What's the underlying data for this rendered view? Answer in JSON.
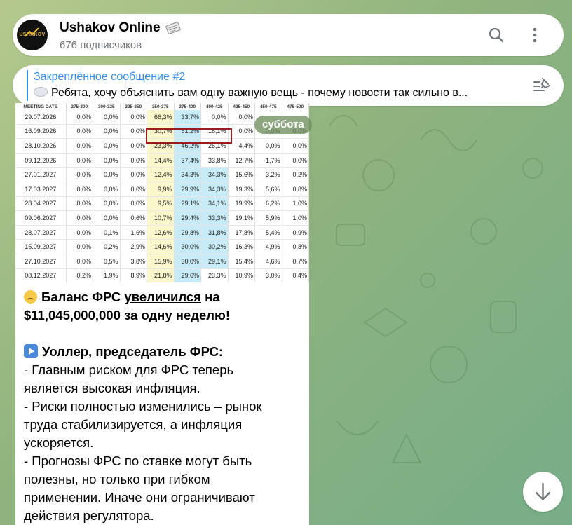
{
  "channel": {
    "name": "Ushakov Online",
    "subscribers": "676 подписчиков",
    "avatar_text": "USHAKOV",
    "title_icon": "newspaper-icon"
  },
  "header_actions": [
    {
      "icon": "search-icon"
    },
    {
      "icon": "more-vertical-icon"
    }
  ],
  "pinned": {
    "title": "Закреплённое сообщение #2",
    "text": "Ребята, хочу объяснить вам одну важную вещь - почему новости так сильно в...",
    "emoji_icon": "cloud-emoji-icon",
    "action_icon": "pinned-list-icon"
  },
  "date_pill": "суббота",
  "table": {
    "columns": [
      "MEETING DATE",
      "275-300",
      "300-325",
      "325-350",
      "350-375",
      "375-400",
      "400-425",
      "425-450",
      "450-475",
      "475-500"
    ],
    "rows": [
      [
        "29.07.2026",
        "0,0%",
        "0,0%",
        "0,0%",
        "66,3%",
        "33,7%",
        "0,0%",
        "0,0%",
        "",
        ""
      ],
      [
        "16.09.2026",
        "0,0%",
        "0,0%",
        "0,0%",
        "30,7%",
        "51,2%",
        "18,1%",
        "0,0%",
        "0,0%",
        "0,0%"
      ],
      [
        "28.10.2026",
        "0,0%",
        "0,0%",
        "0,0%",
        "23,3%",
        "46,2%",
        "26,1%",
        "4,4%",
        "0,0%",
        "0,0%"
      ],
      [
        "09.12.2026",
        "0,0%",
        "0,0%",
        "0,0%",
        "14,4%",
        "37,4%",
        "33,8%",
        "12,7%",
        "1,7%",
        "0,0%"
      ],
      [
        "27.01.2027",
        "0,0%",
        "0,0%",
        "0,0%",
        "12,4%",
        "34,3%",
        "34,3%",
        "15,6%",
        "3,2%",
        "0,2%"
      ],
      [
        "17.03.2027",
        "0,0%",
        "0,0%",
        "0,0%",
        "9,9%",
        "29,9%",
        "34,3%",
        "19,3%",
        "5,6%",
        "0,8%"
      ],
      [
        "28.04.2027",
        "0,0%",
        "0,0%",
        "0,0%",
        "9,5%",
        "29,1%",
        "34,1%",
        "19,9%",
        "6,2%",
        "1,0%"
      ],
      [
        "09.06.2027",
        "0,0%",
        "0,0%",
        "0,6%",
        "10,7%",
        "29,4%",
        "33,3%",
        "19,1%",
        "5,9%",
        "1,0%"
      ],
      [
        "28.07.2027",
        "0,0%",
        "0,1%",
        "1,6%",
        "12,6%",
        "29,8%",
        "31,8%",
        "17,8%",
        "5,4%",
        "0,9%"
      ],
      [
        "15.09.2027",
        "0,0%",
        "0,2%",
        "2,9%",
        "14,6%",
        "30,0%",
        "30,2%",
        "16,3%",
        "4,9%",
        "0,8%"
      ],
      [
        "27.10.2027",
        "0,0%",
        "0,5%",
        "3,8%",
        "15,9%",
        "30,0%",
        "29,1%",
        "15,4%",
        "4,6%",
        "0,7%"
      ],
      [
        "08.12.2027",
        "0,2%",
        "1,9%",
        "8,9%",
        "21,8%",
        "29,6%",
        "23,3%",
        "10,9%",
        "3,0%",
        "0,4%"
      ]
    ],
    "colors": {
      "yellow": "#fbf7cc",
      "blue": "#c8ecf7",
      "highlight_border": "#a11a1a"
    }
  },
  "message": {
    "emoji1": "unamused-face-emoji-icon",
    "l1a": "Баланс ФРС ",
    "l1u": "увеличился",
    "l1b": " на",
    "l2": "$11,045,000,000 за одну неделю!",
    "emoji2": "play-button-emoji-icon",
    "l3": "Уоллер, председатель ФРС:",
    "l4": "- Главным риском для ФРС теперь",
    "l5": "является высокая инфляция.",
    "l6": "- Риски полностью изменились – рынок",
    "l7": "труда стабилизируется, а инфляция",
    "l8": "ускоряется.",
    "l9": "- Прогнозы ФРС по ставке могут быть",
    "l10": "полезны, но только при гибком",
    "l11": "применении. Иначе они ограничивают",
    "l12": "действия регулятора."
  },
  "scroll_button_icon": "arrow-down-icon"
}
